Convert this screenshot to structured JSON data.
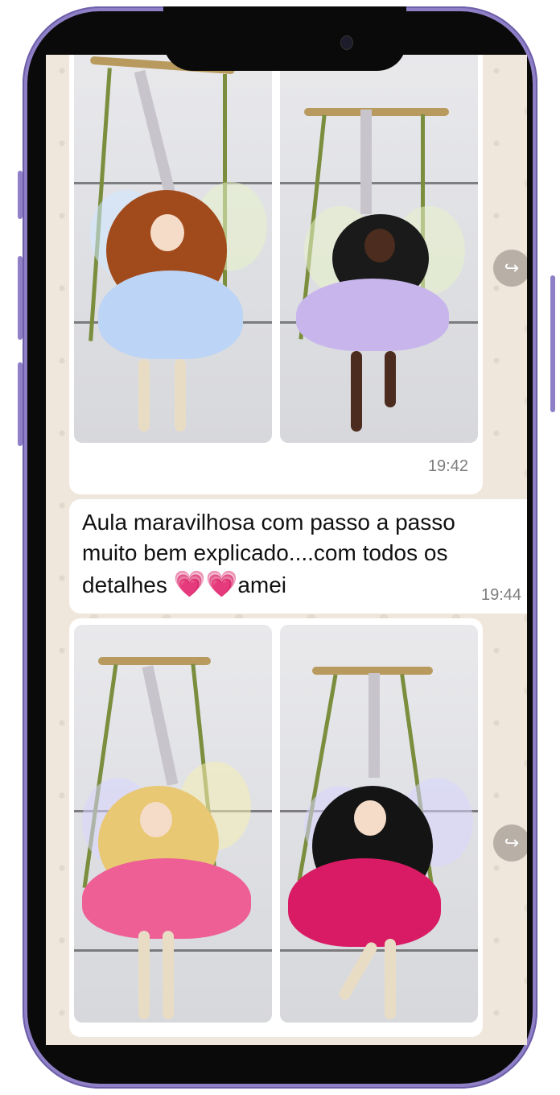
{
  "chat": {
    "messages": [
      {
        "type": "images",
        "time": "19:42"
      },
      {
        "type": "text",
        "text_line1": "Aula maravilhosa com passo a passo",
        "text_line2": "muito bem explicado....com todos os",
        "text_line3_prefix": "detalhes ",
        "text_line3_suffix": "amei",
        "emoji": "💗💗",
        "time": "19:44"
      },
      {
        "type": "images"
      }
    ]
  },
  "icons": {
    "forward": "forward-icon"
  },
  "colors": {
    "frame": "#8e7fc7",
    "chat_bg": "#efe7dc",
    "bubble": "#ffffff"
  }
}
